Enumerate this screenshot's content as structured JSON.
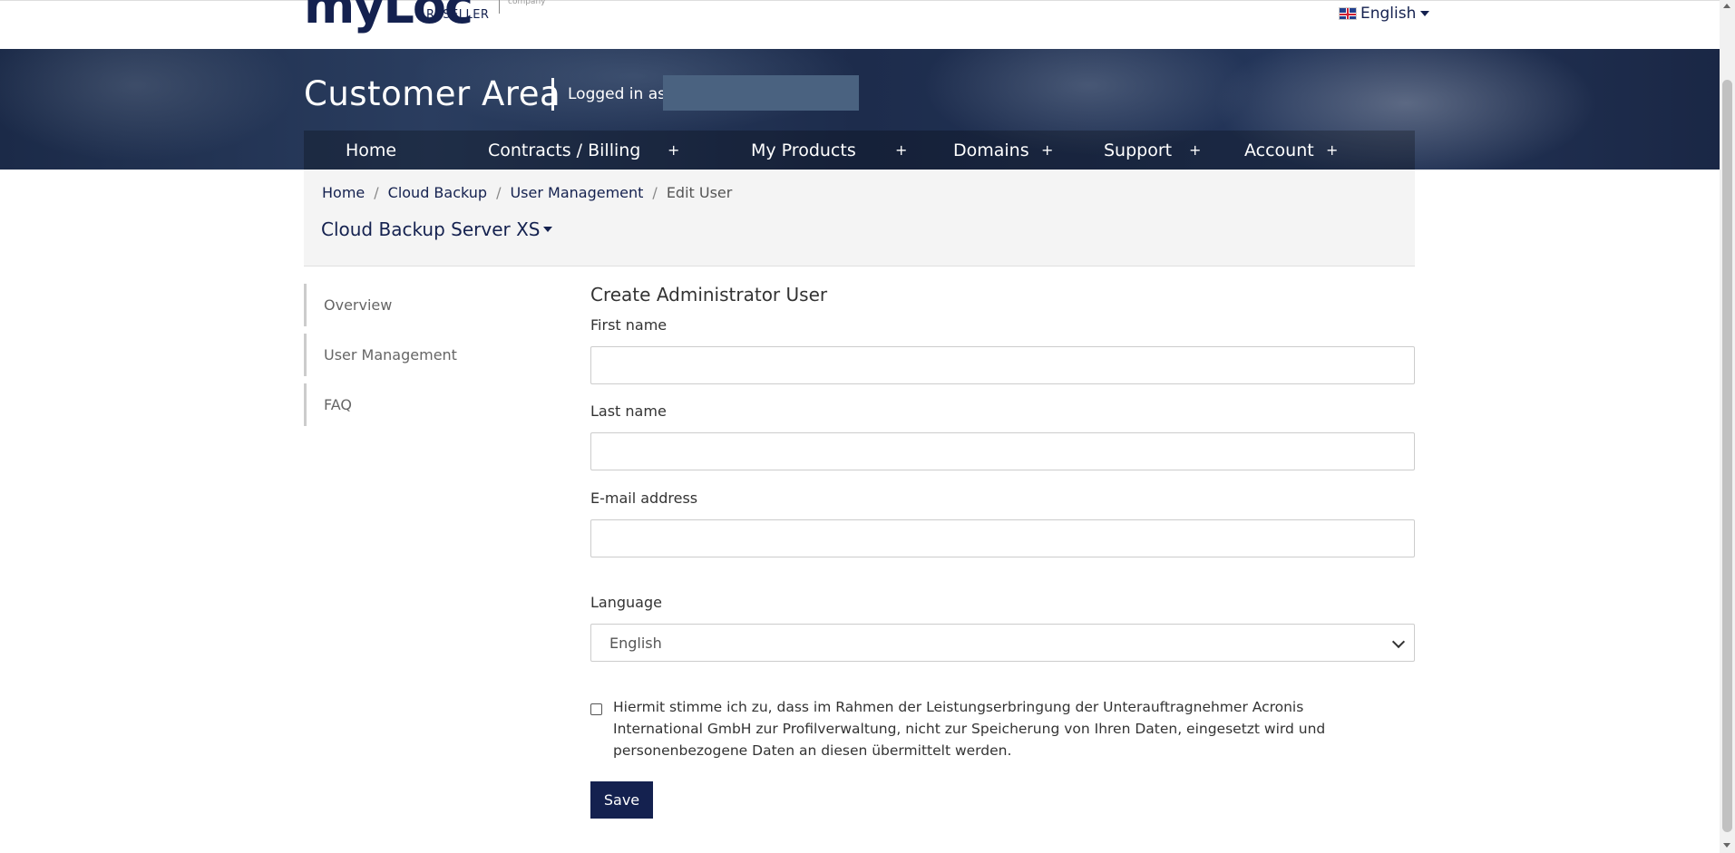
{
  "header": {
    "logo_text": "myLoc",
    "logo_subtext": "RESELLER",
    "logo_company": "company",
    "language": "English"
  },
  "banner": {
    "title": "Customer Area",
    "logged_in_label": "Logged in as",
    "logged_in_user": ""
  },
  "nav": {
    "items": [
      {
        "label": "Home"
      },
      {
        "label": "Contracts / Billing",
        "expand": "+"
      },
      {
        "label": "My Products",
        "expand": "+"
      },
      {
        "label": "Domains",
        "expand": "+"
      },
      {
        "label": "Support",
        "expand": "+"
      },
      {
        "label": "Account",
        "expand": "+"
      }
    ]
  },
  "breadcrumb": {
    "items": [
      "Home",
      "Cloud Backup",
      "User Management",
      "Edit User"
    ],
    "separator": "/"
  },
  "product_select": "Cloud Backup Server XS",
  "sidebar": {
    "items": [
      {
        "label": "Overview"
      },
      {
        "label": "User Management"
      },
      {
        "label": "FAQ"
      }
    ]
  },
  "form": {
    "title": "Create Administrator User",
    "first_name_label": "First name",
    "first_name_value": "",
    "last_name_label": "Last name",
    "last_name_value": "",
    "email_label": "E-mail address",
    "email_value": "",
    "language_label": "Language",
    "language_value": "English",
    "consent_checked": false,
    "consent_text": "Hiermit stimme ich zu, dass im Rahmen der Leistungserbringung der Unterauftragnehmer Acronis International GmbH zur Profilverwaltung, nicht zur Speicherung von Ihren Daten, eingesetzt wird und personenbezogene Daten an diesen übermittelt werden.",
    "save_label": "Save"
  },
  "colors": {
    "brand_navy": "#14214f"
  }
}
